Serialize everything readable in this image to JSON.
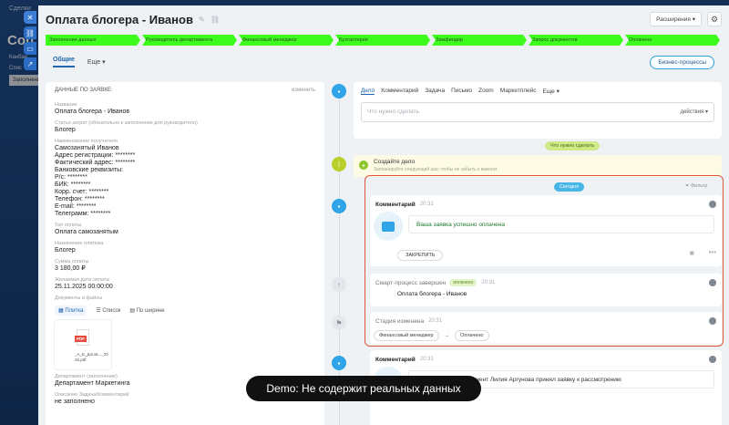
{
  "background": {
    "top_text": "Сделки",
    "title": "Con",
    "side_items": [
      "Канбан",
      "Спис"
    ],
    "tab": "Заполнение"
  },
  "header": {
    "title": "Оплата блогера - Иванов",
    "extensions_label": "Расширения"
  },
  "stages": [
    "Заполнение данных",
    "Руководитель департамента",
    "Финансовый менеджер",
    "Бухгалтерия",
    "Замфиндир",
    "Запрос документов",
    "Оплачено"
  ],
  "stage_color": "#3dfc1d",
  "tabs": {
    "main": "Общие",
    "more": "Еще",
    "bp_button": "Бизнес-процессы"
  },
  "left": {
    "section_title": "ДАННЫЕ ПО ЗАЯВКЕ",
    "edit_label": "изменить",
    "fields": [
      {
        "label": "Название",
        "value": "Оплата блогера - Иванов"
      },
      {
        "label": "Статья затрат (обязательно к заполнению для руководителя)",
        "value": "Блогер"
      },
      {
        "label": "Наименование получателя",
        "value": "Самозанятый Иванов\nАдрес регистрации: ********\nФактический адрес: ********\nБанковские реквизиты:\nР/с: ********\nБИК: ********\nКорр. счет: ********\nТелефон: ********\nE-mail: ********\nТелеграмм: ********"
      },
      {
        "label": "Тип оплаты",
        "value": "Оплата самозанятым"
      },
      {
        "label": "Назначение платежа",
        "value": "Блогер"
      },
      {
        "label": "Сумма оплаты",
        "value": "3 180,00 ₽"
      },
      {
        "label": "Желаемая дата оплаты",
        "value": "25.11.2025 00:00:00"
      }
    ],
    "docs_label": "Документы и файлы",
    "view_tabs": [
      "Плитка",
      "Список",
      "По ширине"
    ],
    "file": {
      "badge": "PDF",
      "name": "_А_Е_Догов..._20\n25.pdf"
    },
    "dept_label": "Департамент (заполнение)",
    "dept_value": "Департамент Маркетинга",
    "desc_label": "Описание Задача/Комментарий",
    "desc_value": "не заполнено"
  },
  "editor": {
    "tabs": [
      "Дело",
      "Комментарий",
      "Задача",
      "Письмо",
      "Zoom",
      "Маркетплейс",
      "Еще"
    ],
    "placeholder": "Что нужно сделать",
    "actions_label": "действия"
  },
  "todo_pill": "Что нужно сделать",
  "create": {
    "title": "Создайте дело",
    "subtitle": "Запланируйте следующий шаг, чтобы не забыть о важном"
  },
  "today_pill": "Сегодня",
  "filter_label": "Фильтр",
  "feed": [
    {
      "type": "comment",
      "title": "Комментарий",
      "time": "20:31",
      "message": "Ваша заявка успешно оплачена",
      "pin_label": "ЗАКРЕПИТЬ"
    },
    {
      "type": "bp",
      "title": "Смарт-процесс завершен",
      "badge": "оплачено",
      "time": "20:31",
      "text": "Оплата блогера - Иванов"
    },
    {
      "type": "stage",
      "title": "Стадия изменена",
      "time": "20:31",
      "from": "Финансовый менеджер",
      "to": "Оплачено"
    },
    {
      "type": "comment",
      "title": "Комментарий",
      "time": "20:31",
      "message": "Финансовый департамент Лилия Аргунова принял заявку к рассмотрению"
    }
  ],
  "caption": "Demo: Не содержит реальных данных"
}
